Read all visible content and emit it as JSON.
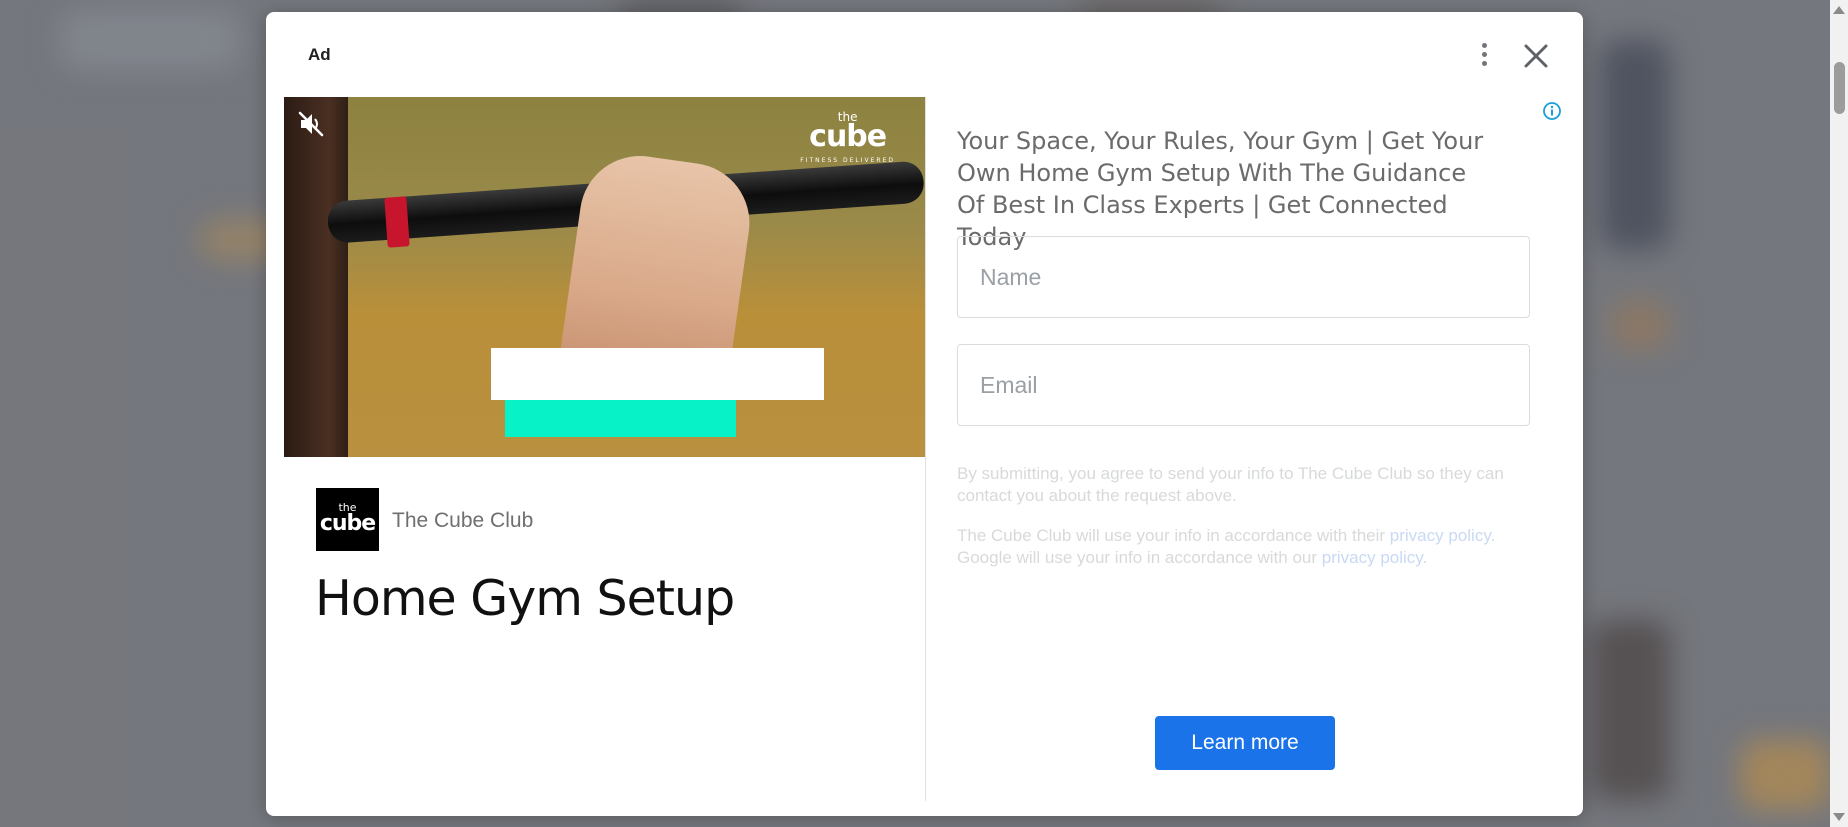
{
  "ad": {
    "label": "Ad",
    "advertiser": {
      "name": "The Cube Club",
      "logo_text_small": "the",
      "logo_text_large": "cube"
    },
    "headline": "Home Gym Setup",
    "description": "Your Space, Your Rules, Your Gym | Get Your Own Home Gym Setup With The Guidance Of Best In Class Experts | Get Connected Today",
    "media": {
      "brand_small": "the",
      "brand_large": "cube",
      "brand_tagline": "FITNESS DELIVERED"
    },
    "form": {
      "name_placeholder": "Name",
      "email_placeholder": "Email",
      "consent": "By submitting, you agree to send your info to The Cube Club so they can contact you about the request above.",
      "privacy_prefix": "The Cube Club will use your info in accordance with their ",
      "privacy_link_1": "privacy policy",
      "privacy_middle": ". Google will use your info in accordance with our ",
      "privacy_link_2": "privacy policy",
      "privacy_suffix": "."
    },
    "cta_label": "Learn more"
  },
  "icons": {
    "close": "close-icon",
    "menu": "more-vert-icon",
    "mute": "volume-off-icon",
    "info": "info-icon"
  },
  "colors": {
    "cta": "#1a73e8",
    "info": "#1a9fd6",
    "teal_block": "#07f2c6"
  }
}
